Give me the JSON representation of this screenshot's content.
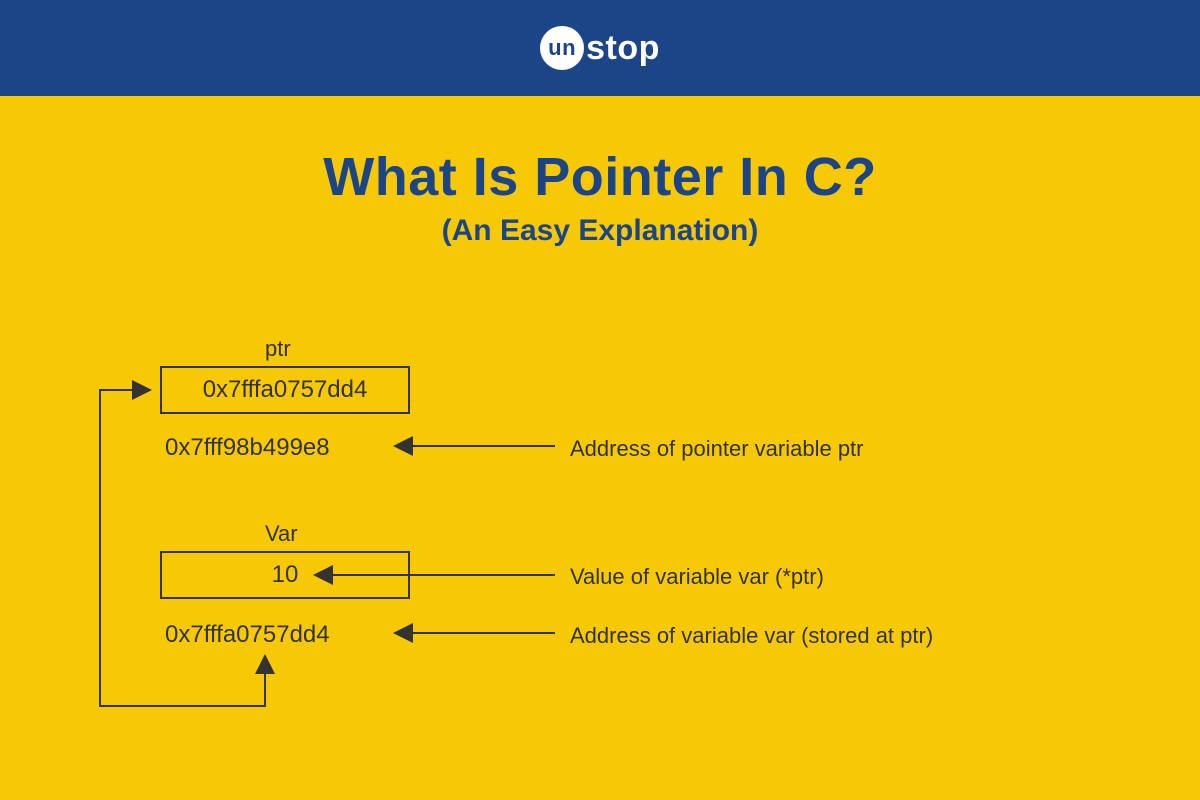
{
  "header": {
    "logo_inner": "un",
    "logo_text": "stop"
  },
  "title": "What Is Pointer In C?",
  "subtitle": "(An Easy Explanation)",
  "diagram": {
    "ptr_label": "ptr",
    "ptr_box_value": "0x7fffa0757dd4",
    "ptr_address": "0x7fff98b499e8",
    "ptr_address_desc": "Address of pointer variable ptr",
    "var_label": "Var",
    "var_box_value": "10",
    "var_value_desc": "Value of variable var (*ptr)",
    "var_address": "0x7fffa0757dd4",
    "var_address_desc": "Address of variable var (stored at ptr)"
  },
  "colors": {
    "header_bg": "#1c4587",
    "main_bg": "#f7c806",
    "text_dark": "#333333"
  }
}
